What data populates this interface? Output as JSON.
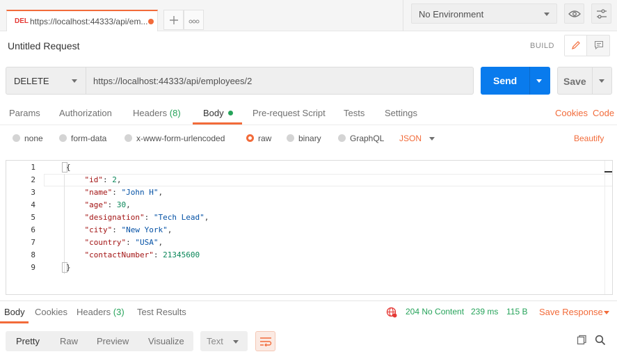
{
  "tab": {
    "method": "DEL",
    "url_short": "https://localhost:44333/api/em...",
    "unsaved": true,
    "new_tab_icon": "plus-icon",
    "more_icon": "ellipsis-icon"
  },
  "environment": {
    "selected": "No Environment",
    "eye_icon": "eye-icon",
    "settings_icon": "sliders-icon"
  },
  "request": {
    "title": "Untitled Request",
    "build_label": "BUILD",
    "method": "DELETE",
    "url": "https://localhost:44333/api/employees/2",
    "send_label": "Send",
    "save_label": "Save"
  },
  "request_tabs": [
    {
      "label": "Params"
    },
    {
      "label": "Authorization"
    },
    {
      "label": "Headers",
      "count": "(8)"
    },
    {
      "label": "Body",
      "active": true
    },
    {
      "label": "Pre-request Script"
    },
    {
      "label": "Tests"
    },
    {
      "label": "Settings"
    }
  ],
  "right_links": {
    "cookies": "Cookies",
    "code": "Code"
  },
  "body_types": [
    {
      "label": "none"
    },
    {
      "label": "form-data"
    },
    {
      "label": "x-www-form-urlencoded"
    },
    {
      "label": "raw",
      "selected": true
    },
    {
      "label": "binary"
    },
    {
      "label": "GraphQL"
    }
  ],
  "raw_format": "JSON",
  "beautify": "Beautify",
  "code_lines": [
    {
      "n": "1",
      "parts": [
        [
          "p",
          "{"
        ]
      ]
    },
    {
      "n": "2",
      "parts": [
        [
          "p",
          "    "
        ],
        [
          "k",
          "\"id\""
        ],
        [
          "p",
          ": "
        ],
        [
          "n",
          "2"
        ],
        [
          "p",
          ","
        ]
      ]
    },
    {
      "n": "3",
      "parts": [
        [
          "p",
          "    "
        ],
        [
          "k",
          "\"name\""
        ],
        [
          "p",
          ": "
        ],
        [
          "s",
          "\"John H\""
        ],
        [
          "p",
          ","
        ]
      ]
    },
    {
      "n": "4",
      "parts": [
        [
          "p",
          "    "
        ],
        [
          "k",
          "\"age\""
        ],
        [
          "p",
          ": "
        ],
        [
          "n",
          "30"
        ],
        [
          "p",
          ","
        ]
      ]
    },
    {
      "n": "5",
      "parts": [
        [
          "p",
          "    "
        ],
        [
          "k",
          "\"designation\""
        ],
        [
          "p",
          ": "
        ],
        [
          "s",
          "\"Tech Lead\""
        ],
        [
          "p",
          ","
        ]
      ]
    },
    {
      "n": "6",
      "parts": [
        [
          "p",
          "    "
        ],
        [
          "k",
          "\"city\""
        ],
        [
          "p",
          ": "
        ],
        [
          "s",
          "\"New York\""
        ],
        [
          "p",
          ","
        ]
      ]
    },
    {
      "n": "7",
      "parts": [
        [
          "p",
          "    "
        ],
        [
          "k",
          "\"country\""
        ],
        [
          "p",
          ": "
        ],
        [
          "s",
          "\"USA\""
        ],
        [
          "p",
          ","
        ]
      ]
    },
    {
      "n": "8",
      "parts": [
        [
          "p",
          "    "
        ],
        [
          "k",
          "\"contactNumber\""
        ],
        [
          "p",
          ": "
        ],
        [
          "n",
          "21345600"
        ]
      ]
    },
    {
      "n": "9",
      "parts": [
        [
          "p",
          "}"
        ]
      ]
    }
  ],
  "response_tabs": [
    {
      "label": "Body",
      "active": true
    },
    {
      "label": "Cookies"
    },
    {
      "label": "Headers",
      "count": "(3)"
    },
    {
      "label": "Test Results"
    }
  ],
  "response_status": {
    "status": "204 No Content",
    "time": "239 ms",
    "size": "115 B",
    "save_response": "Save Response",
    "globe_icon": "globe-warning-icon"
  },
  "view_modes": [
    "Pretty",
    "Raw",
    "Preview",
    "Visualize"
  ],
  "text_format": "Text",
  "colors": {
    "accent": "#f26b3a",
    "send": "#097bed",
    "success": "#26a35a"
  }
}
